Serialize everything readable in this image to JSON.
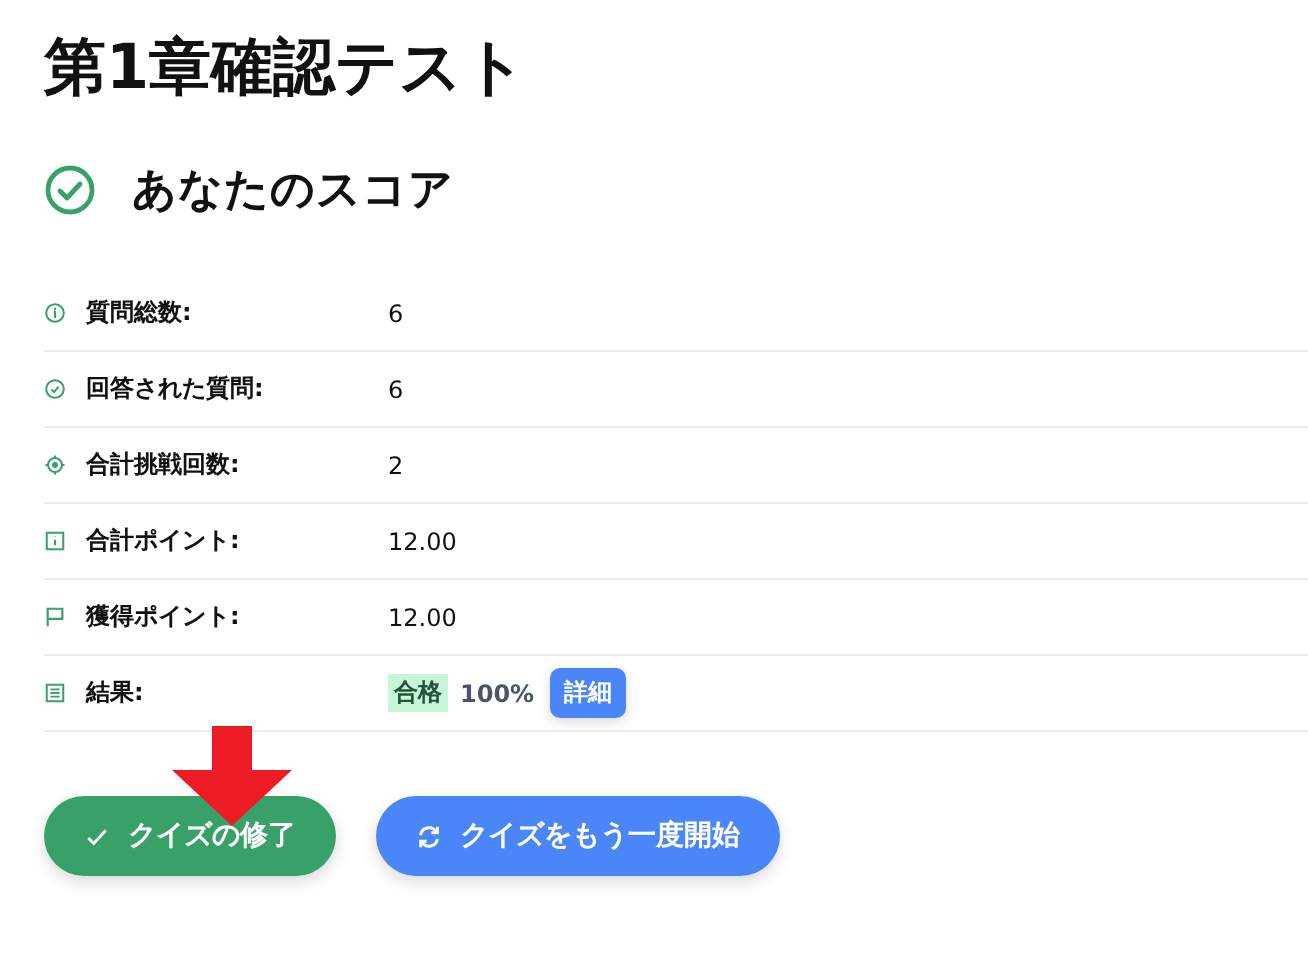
{
  "title": "第1章確認テスト",
  "score_heading": "あなたのスコア",
  "rows": [
    {
      "kind": "text",
      "label": "質問総数:",
      "value": "6"
    },
    {
      "kind": "text",
      "label": "回答された質問:",
      "value": "6"
    },
    {
      "kind": "text",
      "label": "合計挑戦回数:",
      "value": "2"
    },
    {
      "kind": "text",
      "label": "合計ポイント:",
      "value": "12.00"
    },
    {
      "kind": "text",
      "label": "獲得ポイント:",
      "value": "12.00"
    },
    {
      "kind": "result",
      "label": "結果:",
      "badge": "合格",
      "percent": "100%",
      "details": "詳細"
    }
  ],
  "buttons": [
    {
      "kind": "finish",
      "label": "クイズの修了"
    },
    {
      "kind": "restart",
      "label": "クイズをもう一度開始"
    }
  ]
}
